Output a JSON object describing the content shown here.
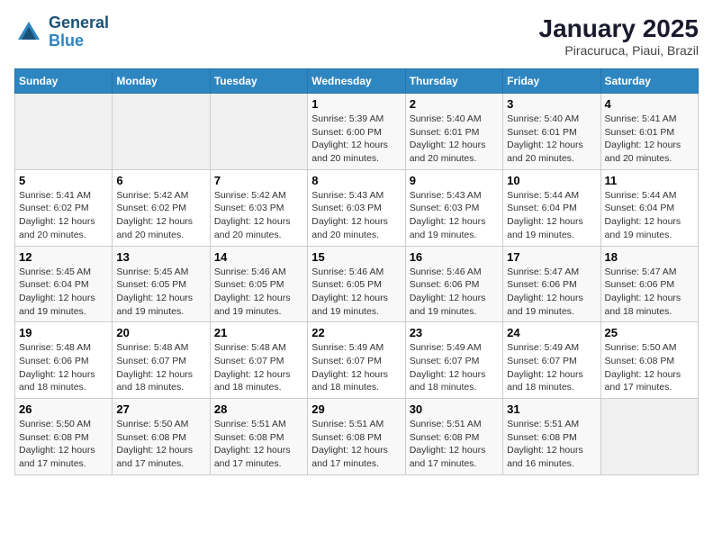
{
  "header": {
    "logo_line1": "General",
    "logo_line2": "Blue",
    "title": "January 2025",
    "subtitle": "Piracuruca, Piaui, Brazil"
  },
  "weekdays": [
    "Sunday",
    "Monday",
    "Tuesday",
    "Wednesday",
    "Thursday",
    "Friday",
    "Saturday"
  ],
  "weeks": [
    [
      {
        "day": "",
        "info": ""
      },
      {
        "day": "",
        "info": ""
      },
      {
        "day": "",
        "info": ""
      },
      {
        "day": "1",
        "info": "Sunrise: 5:39 AM\nSunset: 6:00 PM\nDaylight: 12 hours\nand 20 minutes."
      },
      {
        "day": "2",
        "info": "Sunrise: 5:40 AM\nSunset: 6:01 PM\nDaylight: 12 hours\nand 20 minutes."
      },
      {
        "day": "3",
        "info": "Sunrise: 5:40 AM\nSunset: 6:01 PM\nDaylight: 12 hours\nand 20 minutes."
      },
      {
        "day": "4",
        "info": "Sunrise: 5:41 AM\nSunset: 6:01 PM\nDaylight: 12 hours\nand 20 minutes."
      }
    ],
    [
      {
        "day": "5",
        "info": "Sunrise: 5:41 AM\nSunset: 6:02 PM\nDaylight: 12 hours\nand 20 minutes."
      },
      {
        "day": "6",
        "info": "Sunrise: 5:42 AM\nSunset: 6:02 PM\nDaylight: 12 hours\nand 20 minutes."
      },
      {
        "day": "7",
        "info": "Sunrise: 5:42 AM\nSunset: 6:03 PM\nDaylight: 12 hours\nand 20 minutes."
      },
      {
        "day": "8",
        "info": "Sunrise: 5:43 AM\nSunset: 6:03 PM\nDaylight: 12 hours\nand 20 minutes."
      },
      {
        "day": "9",
        "info": "Sunrise: 5:43 AM\nSunset: 6:03 PM\nDaylight: 12 hours\nand 19 minutes."
      },
      {
        "day": "10",
        "info": "Sunrise: 5:44 AM\nSunset: 6:04 PM\nDaylight: 12 hours\nand 19 minutes."
      },
      {
        "day": "11",
        "info": "Sunrise: 5:44 AM\nSunset: 6:04 PM\nDaylight: 12 hours\nand 19 minutes."
      }
    ],
    [
      {
        "day": "12",
        "info": "Sunrise: 5:45 AM\nSunset: 6:04 PM\nDaylight: 12 hours\nand 19 minutes."
      },
      {
        "day": "13",
        "info": "Sunrise: 5:45 AM\nSunset: 6:05 PM\nDaylight: 12 hours\nand 19 minutes."
      },
      {
        "day": "14",
        "info": "Sunrise: 5:46 AM\nSunset: 6:05 PM\nDaylight: 12 hours\nand 19 minutes."
      },
      {
        "day": "15",
        "info": "Sunrise: 5:46 AM\nSunset: 6:05 PM\nDaylight: 12 hours\nand 19 minutes."
      },
      {
        "day": "16",
        "info": "Sunrise: 5:46 AM\nSunset: 6:06 PM\nDaylight: 12 hours\nand 19 minutes."
      },
      {
        "day": "17",
        "info": "Sunrise: 5:47 AM\nSunset: 6:06 PM\nDaylight: 12 hours\nand 19 minutes."
      },
      {
        "day": "18",
        "info": "Sunrise: 5:47 AM\nSunset: 6:06 PM\nDaylight: 12 hours\nand 18 minutes."
      }
    ],
    [
      {
        "day": "19",
        "info": "Sunrise: 5:48 AM\nSunset: 6:06 PM\nDaylight: 12 hours\nand 18 minutes."
      },
      {
        "day": "20",
        "info": "Sunrise: 5:48 AM\nSunset: 6:07 PM\nDaylight: 12 hours\nand 18 minutes."
      },
      {
        "day": "21",
        "info": "Sunrise: 5:48 AM\nSunset: 6:07 PM\nDaylight: 12 hours\nand 18 minutes."
      },
      {
        "day": "22",
        "info": "Sunrise: 5:49 AM\nSunset: 6:07 PM\nDaylight: 12 hours\nand 18 minutes."
      },
      {
        "day": "23",
        "info": "Sunrise: 5:49 AM\nSunset: 6:07 PM\nDaylight: 12 hours\nand 18 minutes."
      },
      {
        "day": "24",
        "info": "Sunrise: 5:49 AM\nSunset: 6:07 PM\nDaylight: 12 hours\nand 18 minutes."
      },
      {
        "day": "25",
        "info": "Sunrise: 5:50 AM\nSunset: 6:08 PM\nDaylight: 12 hours\nand 17 minutes."
      }
    ],
    [
      {
        "day": "26",
        "info": "Sunrise: 5:50 AM\nSunset: 6:08 PM\nDaylight: 12 hours\nand 17 minutes."
      },
      {
        "day": "27",
        "info": "Sunrise: 5:50 AM\nSunset: 6:08 PM\nDaylight: 12 hours\nand 17 minutes."
      },
      {
        "day": "28",
        "info": "Sunrise: 5:51 AM\nSunset: 6:08 PM\nDaylight: 12 hours\nand 17 minutes."
      },
      {
        "day": "29",
        "info": "Sunrise: 5:51 AM\nSunset: 6:08 PM\nDaylight: 12 hours\nand 17 minutes."
      },
      {
        "day": "30",
        "info": "Sunrise: 5:51 AM\nSunset: 6:08 PM\nDaylight: 12 hours\nand 17 minutes."
      },
      {
        "day": "31",
        "info": "Sunrise: 5:51 AM\nSunset: 6:08 PM\nDaylight: 12 hours\nand 16 minutes."
      },
      {
        "day": "",
        "info": ""
      }
    ]
  ]
}
